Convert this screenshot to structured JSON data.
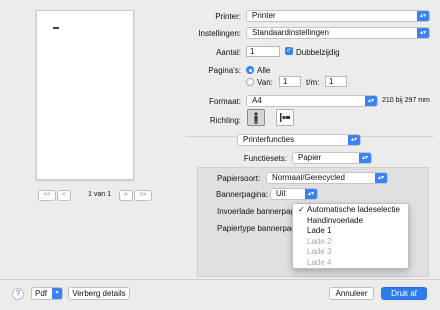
{
  "preview": {
    "page_indicator": "1 van 1",
    "first_label": "<<",
    "prev_label": "<",
    "next_label": ">",
    "last_label": ">>"
  },
  "printer": {
    "label": "Printer:",
    "value": "Printer"
  },
  "presets": {
    "label": "Instellingen:",
    "value": "Standaardinstellingen"
  },
  "copies": {
    "label": "Aantal:",
    "value": "1",
    "duplex_label": "Dubbelzijdig",
    "duplex_checked": true
  },
  "pages": {
    "label": "Pagina's:",
    "all_label": "Alle",
    "range_label": "Van:",
    "from_value": "1",
    "to_label": "t/m:",
    "to_value": "1",
    "selected": "Alle"
  },
  "format": {
    "label": "Formaat:",
    "value": "A4",
    "size_text": "210 bij 297 mm"
  },
  "orientation": {
    "label": "Richting:",
    "selected": "portrait"
  },
  "section_popup": {
    "value": "Printerfuncties"
  },
  "feature_sets": {
    "label": "Functiesets:",
    "value": "Papier"
  },
  "panel": {
    "paper_type_label": "Papiersoort:",
    "paper_type_value": "Normaal/Gerecycled",
    "banner_label": "Bannerpagina:",
    "banner_value": "Uit",
    "banner_tray_label": "Invoerlade bannerpagina:",
    "banner_paper_label": "Papiertype bannerpagina:"
  },
  "tray_menu": {
    "items": [
      {
        "label": "Automatische ladeselectie",
        "checked": true,
        "enabled": true
      },
      {
        "label": "Handinvoerlade",
        "checked": false,
        "enabled": true
      },
      {
        "label": "Lade 1",
        "checked": false,
        "enabled": true
      },
      {
        "label": "Lade 2",
        "checked": false,
        "enabled": false
      },
      {
        "label": "Lade 3",
        "checked": false,
        "enabled": false
      },
      {
        "label": "Lade 4",
        "checked": false,
        "enabled": false
      }
    ]
  },
  "footer": {
    "help_label": "?",
    "pdf_label": "Pdf",
    "hide_details_label": "Verberg details",
    "cancel_label": "Annuleer",
    "print_label": "Druk af"
  },
  "colors": {
    "accent": "#3b82f6",
    "default_button": "#2f7bf0"
  }
}
